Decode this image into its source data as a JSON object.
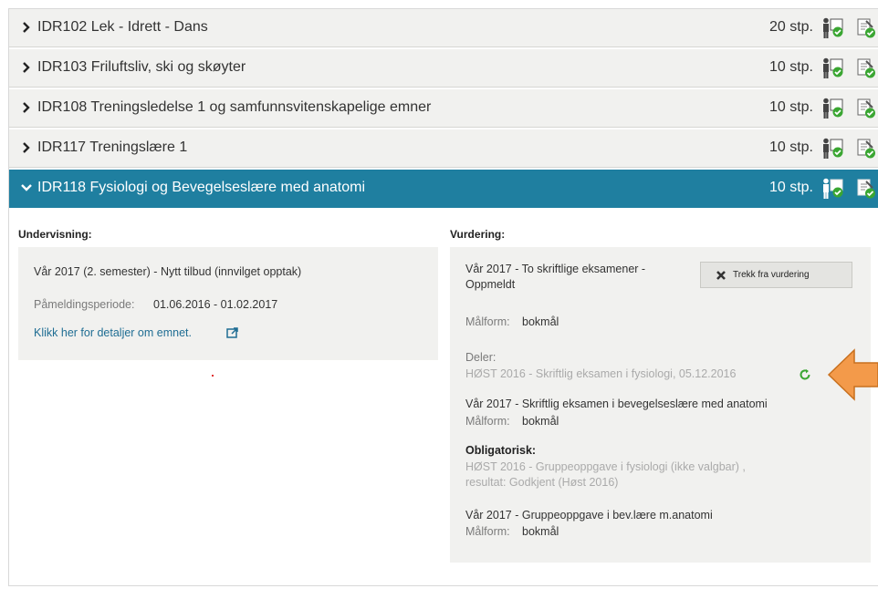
{
  "courses": [
    {
      "code_title": "IDR102 Lek - Idrett - Dans",
      "points": "20 stp."
    },
    {
      "code_title": "IDR103 Friluftsliv, ski og skøyter",
      "points": "10 stp."
    },
    {
      "code_title": "IDR108 Treningsledelse 1 og samfunnsvitenskapelige emner",
      "points": "10 stp."
    },
    {
      "code_title": "IDR117 Treningslære 1",
      "points": "10 stp."
    },
    {
      "code_title": "IDR118 Fysiologi og Bevegelseslære med anatomi",
      "points": "10 stp.",
      "expanded": true
    }
  ],
  "undervisning": {
    "heading": "Undervisning:",
    "semester": "Vår 2017 (2. semester) - Nytt tilbud (innvilget opptak)",
    "period_label": "Påmeldingsperiode:",
    "period_value": "01.06.2016 - 01.02.2017",
    "details_link": "Klikk her for detaljer om emnet."
  },
  "vurdering": {
    "heading": "Vurdering:",
    "exam_line1": "Vår 2017 - To skriftlige eksamener -",
    "exam_line2": "Oppmeldt",
    "withdraw_button": "Trekk fra vurdering",
    "malform_label": "Målform:",
    "malform_value": "bokmål",
    "deler_label": "Deler:",
    "part1": "HØST 2016 - Skriftlig eksamen i fysiologi, 05.12.2016",
    "part2": "Vår 2017 - Skriftlig eksamen i bevegelseslære med anatomi",
    "part2_malform_label": "Målform:",
    "part2_malform_value": "bokmål",
    "obligatorisk_label": "Obligatorisk:",
    "oblig1_line1": "HØST 2016 - Gruppeoppgave i fysiologi (ikke valgbar) ,",
    "oblig1_line2": "resultat: Godkjent (Høst 2016)",
    "oblig2": "Vår 2017 - Gruppeoppgave i bev.lære m.anatomi",
    "oblig2_malform_label": "Målform:",
    "oblig2_malform_value": "bokmål"
  },
  "colors": {
    "active_row": "#1f7fa0",
    "row_bg": "#f1f1ef",
    "link": "#1f6d93",
    "check_green": "#3aa632",
    "annotation_arrow": "#f39a4a"
  },
  "icons": {
    "row_chevron": "chevron-right-icon",
    "expanded_chevron": "chevron-down-icon",
    "registration": "person-checklist-icon",
    "exam": "document-check-icon",
    "external": "external-link-icon",
    "refresh": "refresh-icon",
    "close": "close-icon"
  }
}
